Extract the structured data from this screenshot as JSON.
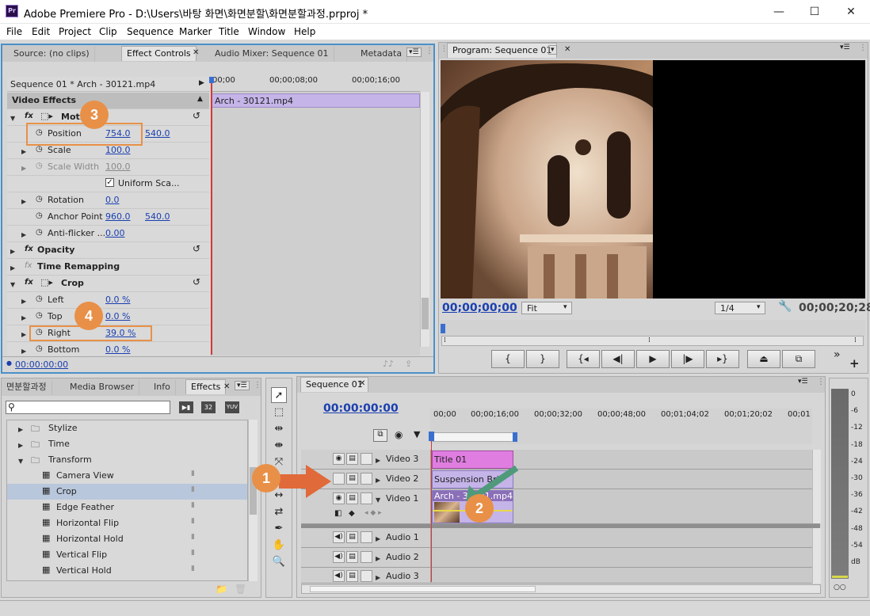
{
  "window": {
    "app_icon": "Pr",
    "title": "Adobe Premiere Pro - D:\\Users\\바탕 화면\\화면분할\\화면분할과정.prproj *",
    "minimize": "—",
    "maximize": "☐",
    "close": "✕"
  },
  "menu": [
    "File",
    "Edit",
    "Project",
    "Clip",
    "Sequence",
    "Marker",
    "Title",
    "Window",
    "Help"
  ],
  "effect_controls": {
    "tabs": [
      "Source: (no clips)",
      "Effect Controls",
      "Audio Mixer: Sequence 01",
      "Metadata"
    ],
    "header": "Sequence 01 * Arch - 30121.mp4",
    "ruler": [
      "00;00",
      "00;00;08;00",
      "00;00;16;00"
    ],
    "clip_bar": "Arch - 30121.mp4",
    "section": "Video Effects",
    "motion_label": "Motion",
    "position": {
      "label": "Position",
      "x": "754.0",
      "y": "540.0"
    },
    "scale": {
      "label": "Scale",
      "value": "100.0"
    },
    "scale_width": {
      "label": "Scale Width",
      "value": "100.0"
    },
    "uniform": "Uniform Sca...",
    "rotation": {
      "label": "Rotation",
      "value": "0.0"
    },
    "anchor": {
      "label": "Anchor Point",
      "x": "960.0",
      "y": "540.0"
    },
    "antiflicker": {
      "label": "Anti-flicker ...",
      "value": "0.00"
    },
    "opacity": "Opacity",
    "time_remap": "Time Remapping",
    "crop": "Crop",
    "left": {
      "label": "Left",
      "value": "0.0 %"
    },
    "top": {
      "label": "Top",
      "value": "0.0 %"
    },
    "right": {
      "label": "Right",
      "value": "39.0 %"
    },
    "bottom": {
      "label": "Bottom",
      "value": "0.0 %"
    },
    "timecode": "00:00:00:00"
  },
  "program": {
    "tab": "Program: Sequence 01",
    "timecode": "00;00;00;00",
    "fit": "Fit",
    "resolution": "1/4",
    "duration": "00;00;20;28"
  },
  "effects_panel": {
    "tabs": [
      "면분할과정",
      "Media Browser",
      "Info",
      "Effects"
    ],
    "badges": [
      "32",
      "YUV"
    ],
    "items": [
      {
        "label": "Stylize",
        "type": "folder",
        "indent": 0
      },
      {
        "label": "Time",
        "type": "folder",
        "indent": 0
      },
      {
        "label": "Transform",
        "type": "folder-open",
        "indent": 0
      },
      {
        "label": "Camera View",
        "type": "effect",
        "indent": 1
      },
      {
        "label": "Crop",
        "type": "effect",
        "indent": 1
      },
      {
        "label": "Edge Feather",
        "type": "effect",
        "indent": 1
      },
      {
        "label": "Horizontal Flip",
        "type": "effect",
        "indent": 1
      },
      {
        "label": "Horizontal Hold",
        "type": "effect",
        "indent": 1
      },
      {
        "label": "Vertical Flip",
        "type": "effect",
        "indent": 1
      },
      {
        "label": "Vertical Hold",
        "type": "effect",
        "indent": 1
      }
    ]
  },
  "sequence": {
    "tab": "Sequence 01",
    "timecode": "00:00:00:00",
    "ruler": [
      "00;00",
      "00;00;16;00",
      "00;00;32;00",
      "00;00;48;00",
      "00;01;04;02",
      "00;01;20;02",
      "00;01"
    ],
    "tracks": {
      "video3": "Video 3",
      "video2": "Video 2",
      "video1": "Video 1",
      "audio1": "Audio 1",
      "audio2": "Audio 2",
      "audio3": "Audio 3"
    },
    "clips": {
      "title": "Title 01",
      "suspension": "Suspension Bri",
      "arch": "Arch - 30121.mp4"
    }
  },
  "meter": {
    "scale": [
      "0",
      "-6",
      "-12",
      "-18",
      "-24",
      "-30",
      "-36",
      "-42",
      "-48",
      "-54",
      "dB"
    ]
  },
  "annotations": [
    "1",
    "2",
    "3",
    "4"
  ],
  "colors": {
    "accent_blue": "#1a3fb0",
    "clip_purple": "#c4b4e8",
    "title_pink": "#e07de0",
    "annot_orange": "#e89048",
    "playhead_red": "#d23a3a"
  }
}
